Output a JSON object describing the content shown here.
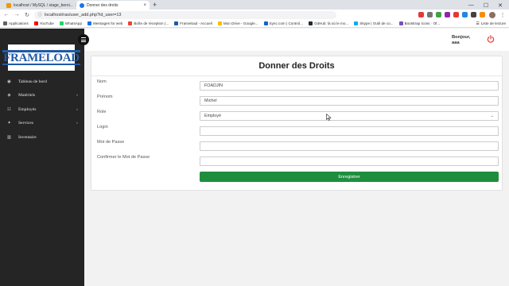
{
  "browser": {
    "tabs": [
      {
        "label": "localhost / MySQL / stage_beroi...",
        "close": "×",
        "color": "#f29900"
      },
      {
        "label": "Donner des droits",
        "close": "×",
        "color": "#1a73e8"
      }
    ],
    "new_tab": "+",
    "window_controls": [
      "—",
      "☐",
      "✕"
    ],
    "url": "localhost/ras/user_add.php?id_user=13",
    "nav": {
      "back": "←",
      "forward": "→",
      "reload": "↻"
    },
    "bookmarks": [
      {
        "label": "Applications",
        "color": "#5f6368"
      },
      {
        "label": "YouTube",
        "color": "#ff0000"
      },
      {
        "label": "WhatsApp",
        "color": "#25d366"
      },
      {
        "label": "Messages for web",
        "color": "#1a73e8"
      },
      {
        "label": "Boîte de réception (...",
        "color": "#ea4335"
      },
      {
        "label": "Frameload - Accueil",
        "color": "#1f5aa6"
      },
      {
        "label": "Mon Drive - Google...",
        "color": "#fbbc04"
      },
      {
        "label": "Sync.com | Control...",
        "color": "#1565c0"
      },
      {
        "label": "GitHub: là où le mo...",
        "color": "#24292e"
      },
      {
        "label": "Skype | Outil de co...",
        "color": "#00aff0"
      },
      {
        "label": "Bootstrap Icons · Of...",
        "color": "#7952b3"
      }
    ],
    "reading_list": "Liste de lecture",
    "extension_colors": [
      "#e53935",
      "#757575",
      "#43a047",
      "#8e24aa",
      "#e53935",
      "#1e88e5",
      "#424242",
      "#fb8c00"
    ]
  },
  "sidebar": {
    "logo_text": "FRAMELOAD",
    "items": [
      {
        "label": "Tableau de bord",
        "icon": "dashboard-icon",
        "glyph": "◉",
        "has_submenu": false
      },
      {
        "label": "Matériels",
        "icon": "layers-icon",
        "glyph": "◈",
        "has_submenu": true
      },
      {
        "label": "Employés",
        "icon": "users-icon",
        "glyph": "☷",
        "has_submenu": true
      },
      {
        "label": "Services",
        "icon": "service-icon",
        "glyph": "✦",
        "has_submenu": true
      },
      {
        "label": "Inventaire",
        "icon": "chart-icon",
        "glyph": "▥",
        "has_submenu": false
      }
    ],
    "chevron": "›"
  },
  "header": {
    "greeting_line1": "Bonjour,",
    "greeting_line2": "aaa",
    "power_color": "#e53935"
  },
  "form": {
    "title": "Donner des Droits",
    "fields": [
      {
        "label": "Nom",
        "value": "FOADJIN"
      },
      {
        "label": "Prénom",
        "value": "Michel"
      },
      {
        "label": "Role",
        "value": "Employé"
      },
      {
        "label": "Login",
        "value": ""
      },
      {
        "label": "Mot de Passe",
        "value": ""
      },
      {
        "label": "Confirmer le Mot de Passe",
        "value": ""
      }
    ],
    "submit_label": "Enregistrer",
    "submit_color": "#1e8e3e"
  }
}
